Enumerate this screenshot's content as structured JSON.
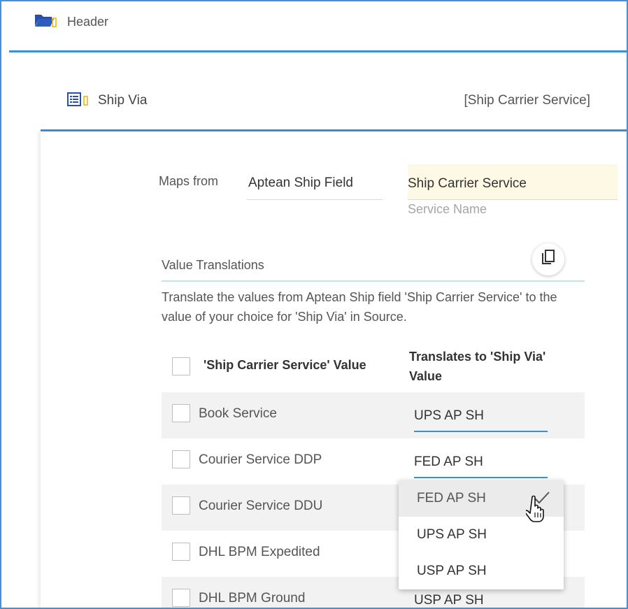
{
  "header": {
    "label": "Header",
    "icon": "folder-open-icon",
    "icon_color": "#2a4fa8"
  },
  "ship_via": {
    "label": "Ship Via",
    "icon": "list-icon",
    "mapped_value": "[Ship Carrier Service]"
  },
  "maps_from": {
    "label": "Maps from",
    "source": "Aptean Ship Field",
    "field": "Ship Carrier Service",
    "field_sub": "Service Name"
  },
  "value_translations": {
    "label": "Value Translations",
    "copy_icon": "copy-icon",
    "description": "Translate the values from Aptean Ship field 'Ship Carrier Service' to the value of your choice for 'Ship Via' in Source."
  },
  "table": {
    "col1_header": "'Ship Carrier Service' Value",
    "col2_header": "Translates to 'Ship Via' Value",
    "rows": [
      {
        "name": "Book Service",
        "translation": "UPS AP SH"
      },
      {
        "name": "Courier Service DDP",
        "translation": "FED AP SH"
      },
      {
        "name": "Courier Service DDU",
        "translation": ""
      },
      {
        "name": "DHL BPM Expedited",
        "translation": ""
      },
      {
        "name": "DHL BPM Ground",
        "translation": "USP AP SH"
      }
    ]
  },
  "dropdown": {
    "options": [
      "FED AP SH",
      "UPS AP SH",
      "USP AP SH"
    ],
    "selected": "FED AP SH"
  },
  "colors": {
    "accent": "#3b8fd9",
    "highlight": "#fdf9e4",
    "row_shade": "#f2f2f2"
  }
}
